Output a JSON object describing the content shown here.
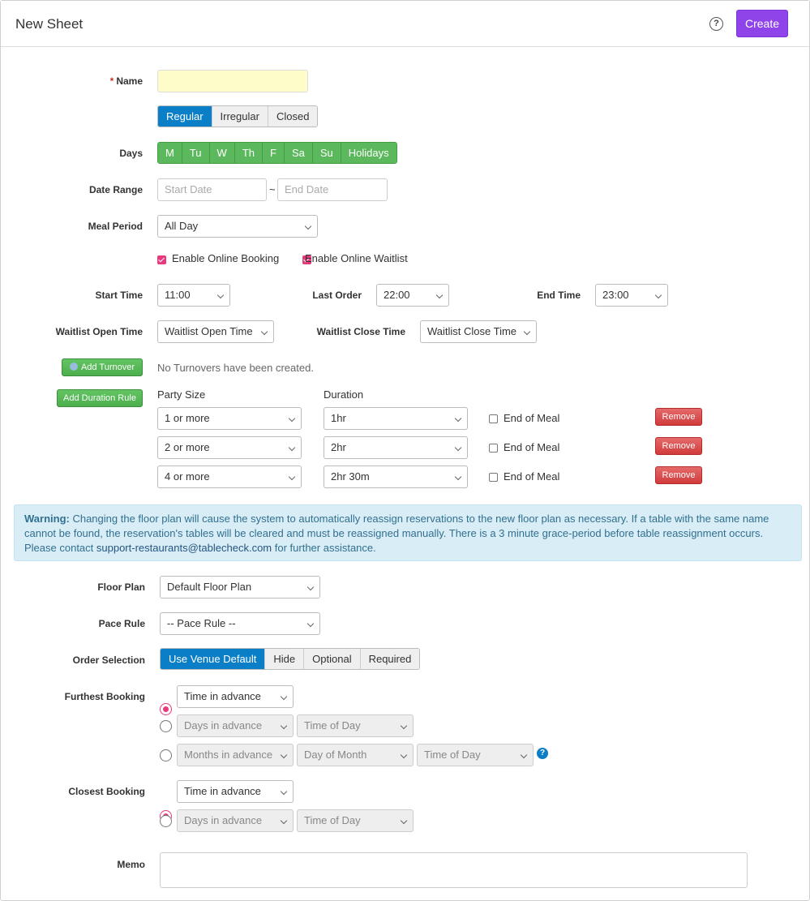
{
  "header": {
    "title": "New Sheet",
    "help_icon": "?",
    "create_label": "Create"
  },
  "name": {
    "label": "Name",
    "required_mark": "*",
    "value": ""
  },
  "schedule_type": {
    "options": [
      "Regular",
      "Irregular",
      "Closed"
    ],
    "selected": "Regular"
  },
  "days": {
    "label": "Days",
    "options": [
      "M",
      "Tu",
      "W",
      "Th",
      "F",
      "Sa",
      "Su",
      "Holidays"
    ]
  },
  "date_range": {
    "label": "Date Range",
    "start_placeholder": "Start Date",
    "separator": "~",
    "end_placeholder": "End Date"
  },
  "meal_period": {
    "label": "Meal Period",
    "value": "All Day"
  },
  "options": {
    "online_booking": "Enable Online Booking",
    "online_waitlist": "Enable Online Waitlist"
  },
  "times": {
    "start_label": "Start Time",
    "start_value": "11:00",
    "last_order_label": "Last Order",
    "last_order_value": "22:00",
    "end_label": "End Time",
    "end_value": "23:00"
  },
  "waitlist": {
    "open_label": "Waitlist Open Time",
    "open_value": "Waitlist Open Time",
    "close_label": "Waitlist Close Time",
    "close_value": "Waitlist Close Time"
  },
  "turnover": {
    "button": "Add Turnover",
    "empty_text": "No Turnovers have been created."
  },
  "duration": {
    "button": "Add Duration Rule",
    "party_header": "Party Size",
    "duration_header": "Duration",
    "end_of_meal_label": "End of Meal",
    "remove_label": "Remove",
    "rules": [
      {
        "party": "1 or more",
        "duration": "1hr"
      },
      {
        "party": "2 or more",
        "duration": "2hr"
      },
      {
        "party": "4 or more",
        "duration": "2hr 30m"
      }
    ]
  },
  "warning": {
    "title": "Warning:",
    "text": " Changing the floor plan will cause the system to automatically reassign reservations to the new floor plan as necessary. If a table with the same name cannot be found, the reservation's tables will be cleared and must be reassigned manually. There is a 3 minute grace-period before table reassignment occurs. Please contact ",
    "email": "support-restaurants@tablecheck.com",
    "tail": " for further assistance."
  },
  "floor_plan": {
    "label": "Floor Plan",
    "value": "Default Floor Plan"
  },
  "pace_rule": {
    "label": "Pace Rule",
    "value": "-- Pace Rule --"
  },
  "order_selection": {
    "label": "Order Selection",
    "options": [
      "Use Venue Default",
      "Hide",
      "Optional",
      "Required"
    ],
    "selected": "Use Venue Default"
  },
  "furthest": {
    "label": "Furthest Booking",
    "time_in_advance": "Time in advance",
    "days_in_advance": "Days in advance",
    "time_of_day": "Time of Day",
    "months_in_advance": "Months in advance",
    "day_of_month": "Day of Month",
    "time_of_day2": "Time of Day"
  },
  "closest": {
    "label": "Closest Booking",
    "time_in_advance": "Time in advance",
    "days_in_advance": "Days in advance",
    "time_of_day": "Time of Day"
  },
  "memo": {
    "label": "Memo",
    "value": ""
  },
  "colors": {
    "primary": "#0a7fc7",
    "create": "#8e44e8",
    "days": "#5cb85c",
    "remove": "#d9534f",
    "accent": "#e8397d"
  }
}
